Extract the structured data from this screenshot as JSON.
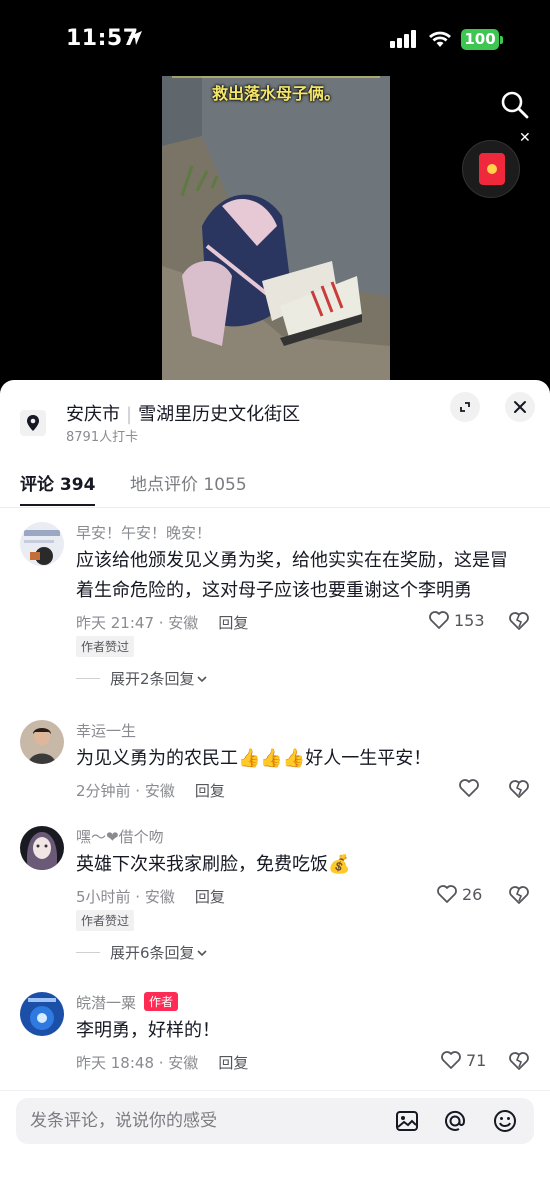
{
  "status_bar": {
    "time": "11:57",
    "battery": "100"
  },
  "video": {
    "caption": "救出落水母子俩。"
  },
  "poi": {
    "city": "安庆市",
    "place": "雪湖里历史文化街区",
    "checkins": "8791人打卡"
  },
  "tabs": [
    {
      "label": "评论 394",
      "active": true
    },
    {
      "label": "地点评价 1055",
      "active": false
    }
  ],
  "comments": [
    {
      "username": "早安！午安！晚安！",
      "text": "应该给他颁发见义勇为奖，给他实实在在奖励，这是冒着生命危险的，这对母子应该也要重谢这个李明勇",
      "time": "昨天 21:47 · 安徽",
      "reply": "回复",
      "likes": "153",
      "author_liked": "作者赞过",
      "expand": "展开2条回复"
    },
    {
      "username": "幸运一生",
      "text": "为见义勇为的农民工👍👍👍好人一生平安！",
      "time": "2分钟前 · 安徽",
      "reply": "回复",
      "likes": ""
    },
    {
      "username": "嘿～❤借个吻",
      "text": "英雄下次来我家刷脸，免费吃饭💰",
      "time": "5小时前 · 安徽",
      "reply": "回复",
      "likes": "26",
      "author_liked": "作者赞过",
      "expand": "展开6条回复"
    },
    {
      "username": "皖潜一粟",
      "author_tag": "作者",
      "text": "李明勇，好样的！",
      "time": "昨天 18:48 · 安徽",
      "reply": "回复",
      "likes": "71"
    }
  ],
  "input": {
    "placeholder": "发条评论，说说你的感受"
  },
  "icons": [
    "location-arrow-icon",
    "signal-icon",
    "wifi-icon",
    "search-icon",
    "red-packet-icon",
    "close-icon",
    "map-pin-icon",
    "expand-icon",
    "heart-icon",
    "broken-heart-icon",
    "image-icon",
    "at-icon",
    "emoji-icon",
    "chevron-down-icon"
  ]
}
